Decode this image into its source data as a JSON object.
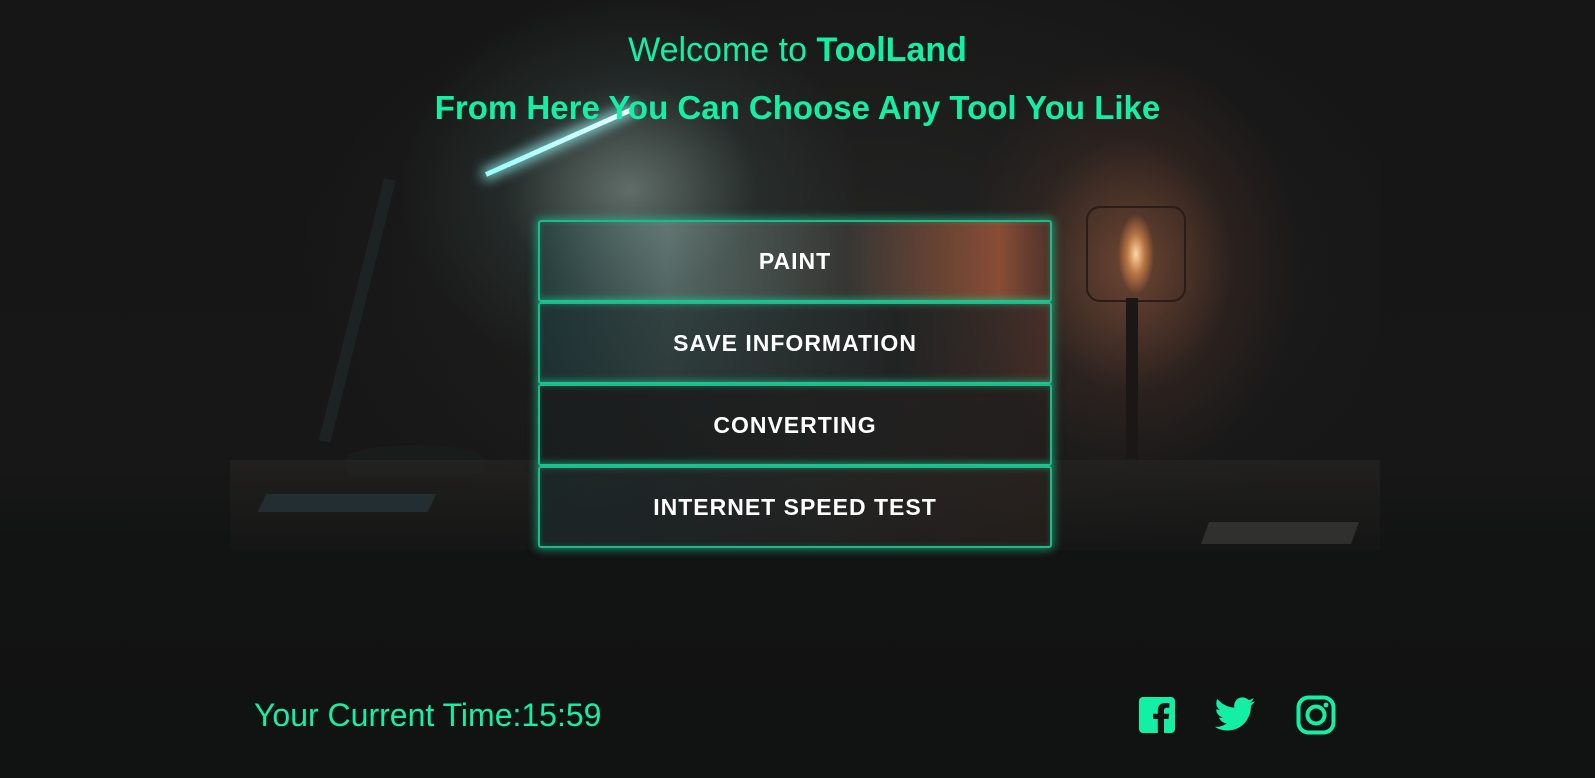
{
  "header": {
    "welcome_prefix": "Welcome to ",
    "brand": "ToolLand",
    "subtitle": "From Here You Can Choose Any Tool You Like"
  },
  "menu": {
    "items": [
      {
        "label": "PAINT"
      },
      {
        "label": "SAVE INFORMATION"
      },
      {
        "label": "CONVERTING"
      },
      {
        "label": "INTERNET SPEED TEST"
      }
    ]
  },
  "footer": {
    "time_label": "Your Current Time:",
    "time_value": "15:59",
    "social": [
      {
        "icon": "facebook-icon"
      },
      {
        "icon": "twitter-icon"
      },
      {
        "icon": "instagram-icon"
      }
    ]
  },
  "colors": {
    "accent": "#13f0a5",
    "button_text": "#ffffff",
    "background": "#141414"
  }
}
